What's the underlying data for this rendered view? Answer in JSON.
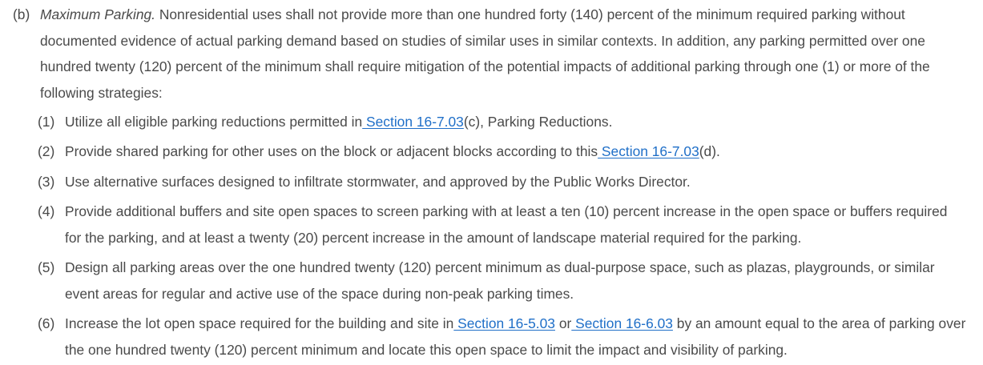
{
  "paragraph": {
    "marker": "(b)",
    "heading": "Maximum Parking.",
    "text": " Nonresidential uses shall not provide more than one hundred forty (140) percent of the minimum required parking without documented evidence of actual parking demand based on studies of similar uses in similar contexts. In addition, any parking permitted over one hundred twenty (120) percent of the minimum shall require mitigation of the potential impacts of additional parking through one (1) or more of the following strategies:"
  },
  "items": [
    {
      "num": "(1)",
      "t1": "Utilize all eligible parking reductions permitted in",
      "link1": " Section 16-7.03",
      "t2": "(c), Parking Reductions."
    },
    {
      "num": "(2)",
      "t1": "Provide shared parking for other uses on the block or adjacent blocks according to this",
      "link1": " Section 16-7.03",
      "t2": "(d)."
    },
    {
      "num": "(3)",
      "t1": "Use alternative surfaces designed to infiltrate stormwater, and approved by the Public Works Director."
    },
    {
      "num": "(4)",
      "t1": "Provide additional buffers and site open spaces to screen parking with at least a ten (10) percent increase in the open space or buffers required for the parking, and at least a twenty (20) percent increase in the amount of landscape material required for the parking."
    },
    {
      "num": "(5)",
      "t1": "Design all parking areas over the one hundred twenty (120) percent minimum as dual-purpose space, such as plazas, playgrounds, or similar event areas for regular and active use of the space during non-peak parking times."
    },
    {
      "num": "(6)",
      "t1": "Increase the lot open space required for the building and site in",
      "link1": " Section 16-5.03",
      "t2": " or",
      "link2": " Section 16-6.03",
      "t3": " by an amount equal to the area of parking over the one hundred twenty (120) percent minimum and locate this open space to limit the impact and visibility of parking."
    }
  ]
}
